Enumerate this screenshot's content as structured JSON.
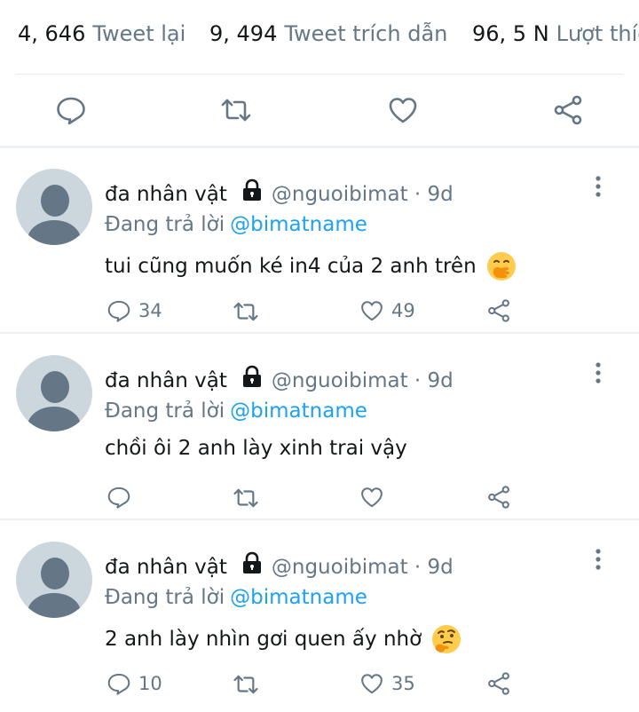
{
  "stats": {
    "retweets_count": "4, 646",
    "retweets_label": "Tweet lại",
    "quotes_count": "9, 494",
    "quotes_label": "Tweet trích dẫn",
    "likes_count": "96, 5 N",
    "likes_label": "Lượt thích"
  },
  "actions": {
    "icons": [
      "reply-icon",
      "retweet-icon",
      "like-icon",
      "share-icon"
    ]
  },
  "replies": [
    {
      "name": "đa nhân vật",
      "handle": "@nguoibimat · 9d",
      "replying_text": "Đang trả lời",
      "mention": "@bimatname",
      "text": "tui cũng muốn ké in4 của 2 anh trên",
      "emoji": "face-with-hand-over-mouth",
      "reply_count": "34",
      "like_count": "49"
    },
    {
      "name": "đa nhân vật",
      "handle": "@nguoibimat · 9d",
      "replying_text": "Đang trả lời",
      "mention": "@bimatname",
      "text": "chồi ôi 2 anh lày xinh trai vậy",
      "emoji": "",
      "reply_count": "",
      "like_count": ""
    },
    {
      "name": "đa nhân vật",
      "handle": "@nguoibimat · 9d",
      "replying_text": "Đang trả lời",
      "mention": "@bimatname",
      "text": "2 anh lày nhìn gơi quen ấy nhờ",
      "emoji": "thinking-face",
      "reply_count": "10",
      "like_count": "35"
    }
  ],
  "colors": {
    "link": "#1da1f2",
    "secondary_text": "#657786",
    "primary_text": "#14171a",
    "divider": "#e6ecf0"
  }
}
